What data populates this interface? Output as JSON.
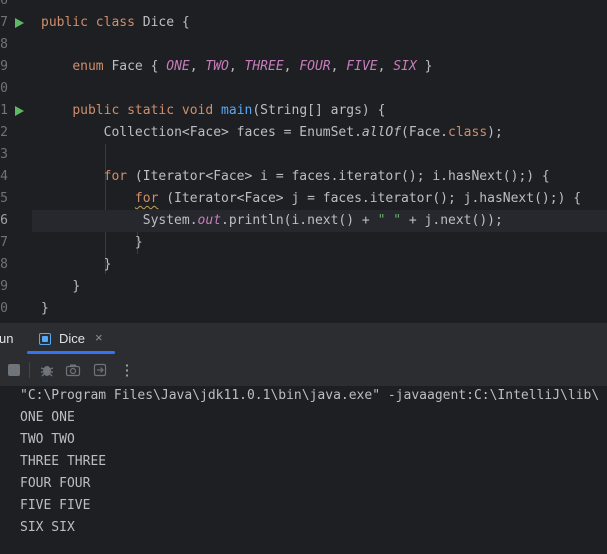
{
  "editor": {
    "line_numbers": [
      "6",
      "7",
      "8",
      "9",
      "0",
      "1",
      "2",
      "3",
      "4",
      "5",
      "6",
      "7",
      "8",
      "9",
      "0"
    ],
    "lines": {
      "l7": {
        "kw1": "public",
        "kw2": "class",
        "name": "Dice",
        "brace": "{"
      },
      "l9": {
        "kw": "enum",
        "name": "Face",
        "open": "{",
        "c1": "ONE",
        "c2": "TWO",
        "c3": "THREE",
        "c4": "FOUR",
        "c5": "FIVE",
        "c6": "SIX",
        "close": "}",
        "comma": ","
      },
      "l11": {
        "kw1": "public",
        "kw2": "static",
        "kw3": "void",
        "fn": "main",
        "params": "(String[] args) {"
      },
      "l12": {
        "pre": "Collection<Face> faces = EnumSet.",
        "fn": "allOf",
        "mid": "(Face.",
        "kw": "class",
        "post": ");"
      },
      "l14": {
        "kw": "for",
        "rest": " (Iterator<Face> i = faces.iterator(); i.hasNext();) {"
      },
      "l15": {
        "kw": "for",
        "rest": " (Iterator<Face> j = faces.iterator(); j.hasNext();) {"
      },
      "l16": {
        "pre": "System.",
        "field": "out",
        "mid": ".println(i.next() + ",
        "str": "\" \"",
        "post": " + j.next());"
      },
      "close": "}"
    }
  },
  "run_panel": {
    "run_label": "un",
    "tab_label": "Dice",
    "close_glyph": "×",
    "more_glyph": "⋮"
  },
  "console": {
    "lines": [
      "\"C:\\Program Files\\Java\\jdk11.0.1\\bin\\java.exe\" -javaagent:C:\\IntelliJ\\lib\\",
      "ONE ONE",
      "TWO TWO",
      "THREE THREE",
      "FOUR FOUR",
      "FIVE FIVE",
      "SIX SIX"
    ]
  },
  "icons": {
    "run": "run-gutter-icon",
    "stop": "stop-icon",
    "debug": "bug-icon",
    "screenshot": "camera-icon",
    "exit": "exit-icon",
    "more": "more-vertical-icon"
  },
  "colors": {
    "keyword": "#cf8e6d",
    "function": "#56a8f5",
    "constant": "#c77dbb",
    "string": "#6aab73",
    "accent": "#3574f0",
    "run": "#5fb865"
  }
}
